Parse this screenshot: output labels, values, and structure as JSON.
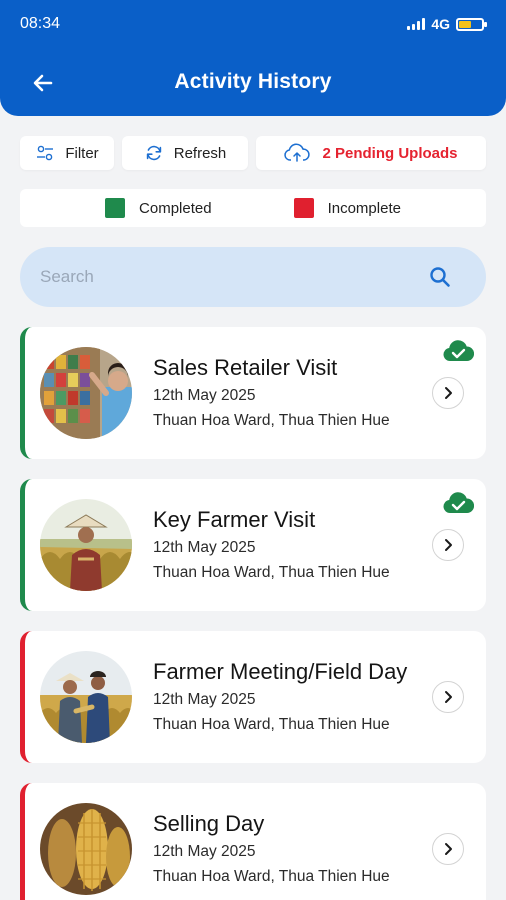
{
  "status_bar": {
    "time": "08:34",
    "network": "4G"
  },
  "header": {
    "title": "Activity History"
  },
  "toolbar": {
    "filter_label": "Filter",
    "refresh_label": "Refresh",
    "pending_label": "2 Pending Uploads"
  },
  "legend": {
    "completed_label": "Completed",
    "incomplete_label": "Incomplete",
    "completed_color": "#1f8a4c",
    "incomplete_color": "#e0202f"
  },
  "search": {
    "placeholder": "Search",
    "value": ""
  },
  "activities": [
    {
      "title": "Sales Retailer Visit",
      "date": "12th May 2025",
      "location": "Thuan Hoa Ward, Thua Thien Hue",
      "status": "completed",
      "uploaded": true
    },
    {
      "title": "Key Farmer Visit",
      "date": "12th May 2025",
      "location": "Thuan Hoa Ward, Thua Thien Hue",
      "status": "completed",
      "uploaded": true
    },
    {
      "title": "Farmer Meeting/Field Day",
      "date": "12th May 2025",
      "location": "Thuan Hoa Ward, Thua Thien Hue",
      "status": "incomplete",
      "uploaded": false
    },
    {
      "title": "Selling Day",
      "date": "12th May 2025",
      "location": "Thuan Hoa Ward, Thua Thien Hue",
      "status": "incomplete",
      "uploaded": false
    }
  ],
  "colors": {
    "primary": "#0a5fc8",
    "search_bg": "#d5e5f7",
    "pending_text": "#e52330",
    "upload_ok": "#1f8a4c"
  }
}
